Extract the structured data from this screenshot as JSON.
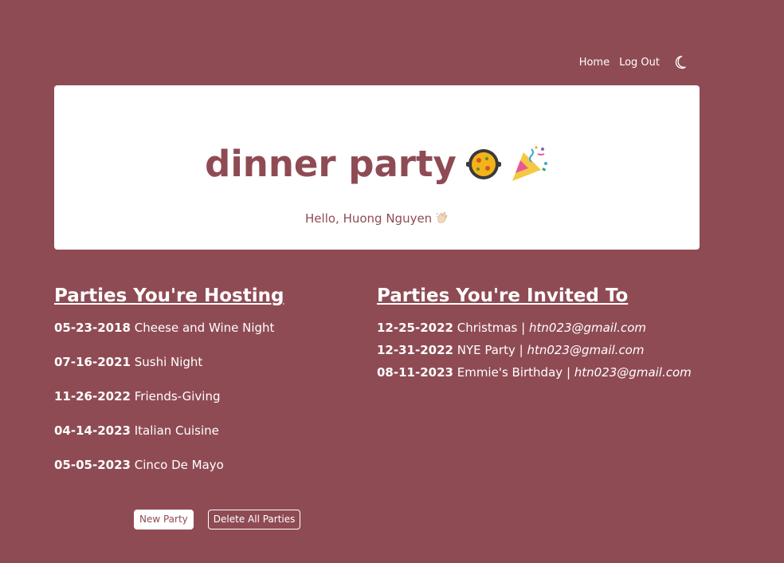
{
  "nav": {
    "home_label": "Home",
    "logout_label": "Log Out",
    "theme_icon": "moon-icon"
  },
  "hero": {
    "title": "dinner party",
    "title_emojis": [
      "paella-pan-icon",
      "party-popper-icon"
    ],
    "greeting": "Hello, Huong Nguyen",
    "greeting_emoji": "waving-hand-icon"
  },
  "hosting": {
    "heading": "Parties You're Hosting",
    "parties": [
      {
        "date": "05-23-2018",
        "name": "Cheese and Wine Night"
      },
      {
        "date": "07-16-2021",
        "name": "Sushi Night"
      },
      {
        "date": "11-26-2022",
        "name": "Friends-Giving"
      },
      {
        "date": "04-14-2023",
        "name": "Italian Cuisine"
      },
      {
        "date": "05-05-2023",
        "name": "Cinco De Mayo"
      }
    ]
  },
  "invited": {
    "heading": "Parties You're Invited To",
    "parties": [
      {
        "date": "12-25-2022",
        "name": "Christmas",
        "separator": "|",
        "host": "htn023@gmail.com"
      },
      {
        "date": "12-31-2022",
        "name": "NYE Party",
        "separator": "|",
        "host": "htn023@gmail.com"
      },
      {
        "date": "08-11-2023",
        "name": "Emmie's Birthday",
        "separator": "|",
        "host": "htn023@gmail.com"
      }
    ]
  },
  "actions": {
    "new_party_label": "New Party",
    "delete_all_label": "Delete All Parties"
  },
  "colors": {
    "background": "#8f4b54",
    "card": "#ffffff",
    "accent": "#8f4b54"
  }
}
